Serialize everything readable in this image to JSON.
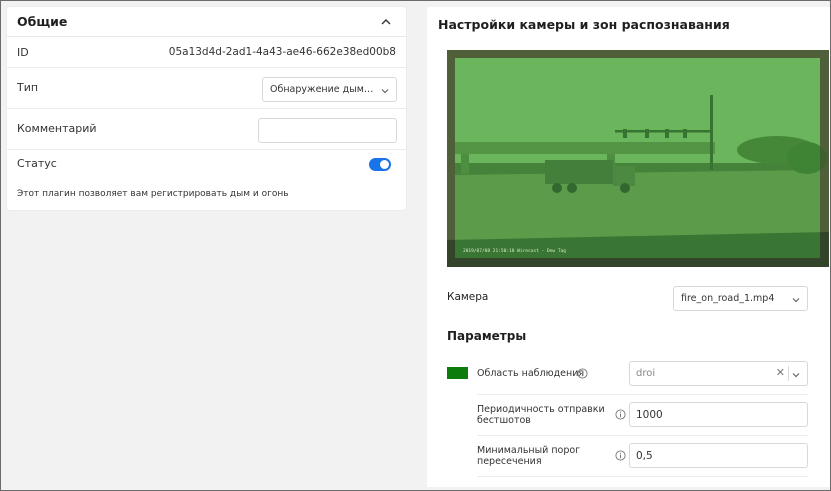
{
  "general": {
    "title": "Общие",
    "rows": {
      "id_label": "ID",
      "id_value": "05a13d4d-2ad1-4a43-ae46-662e38ed00b8",
      "type_label": "Тип",
      "type_value": "Обнаружение дыма и огня",
      "comment_label": "Комментарий",
      "comment_value": "",
      "status_label": "Статус",
      "status_on": true
    },
    "description": "Этот плагин позволяет вам регистрировать дым и огонь"
  },
  "camera_settings": {
    "title": "Настройки камеры и зон распознавания",
    "overlay_color": "#3fa03a",
    "timestamp": "2019/07/08 21:50:18 Wirecast · Dew Tag",
    "camera_label": "Камера",
    "camera_value": "fire_on_road_1.mp4",
    "params_title": "Параметры",
    "params": {
      "area_label": "Область наблюдения",
      "area_color": "#0c7d0c",
      "area_value": "droi",
      "burst_label_line1": "Периодичность отправки",
      "burst_label_line2": "бестшотов",
      "burst_value": "1000",
      "threshold_label_line1": "Минимальный порог",
      "threshold_label_line2": "пересечения",
      "threshold_value": "0,5"
    }
  }
}
